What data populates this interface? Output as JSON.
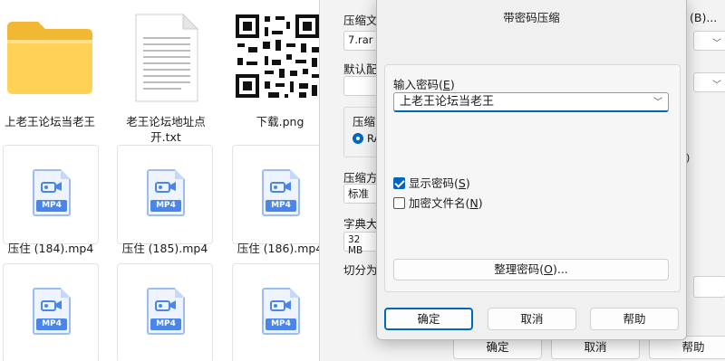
{
  "explorer": {
    "folder": {
      "label": "上老王论坛当老王"
    },
    "txt": {
      "label": "老王论坛地址点开.txt"
    },
    "png": {
      "label": "下载.png"
    },
    "mp4_badge": "MP4",
    "videos": [
      {
        "label": "压住 (184).mp4"
      },
      {
        "label": "压住 (185).mp4"
      },
      {
        "label": "压住 (186).mp4"
      }
    ]
  },
  "archive_dialog": {
    "archive_name_label": "压缩文",
    "browse_button": "(B)...",
    "archive_name_value": "7.rar",
    "default_profile_label": "默认配",
    "format_label": "压缩",
    "format_option": "RA",
    "method_label": "压缩方",
    "method_value": "标准",
    "dict_label": "字典大",
    "dict_value": "32 MB",
    "split_label": "切分为",
    "ok": "确定",
    "cancel": "取消",
    "help": "帮助"
  },
  "password_dialog": {
    "title": "带密码压缩",
    "enter_password_label": "输入密码",
    "enter_password_key": "E",
    "password_value": "上老王论坛当老王",
    "show_password": {
      "label": "显示密码",
      "key": "S",
      "checked": true
    },
    "encrypt_names": {
      "label": "加密文件名",
      "key": "N",
      "checked": false
    },
    "manage_button": "整理密码",
    "manage_key": "O",
    "ok": "确定",
    "cancel": "取消",
    "help": "帮助"
  }
}
